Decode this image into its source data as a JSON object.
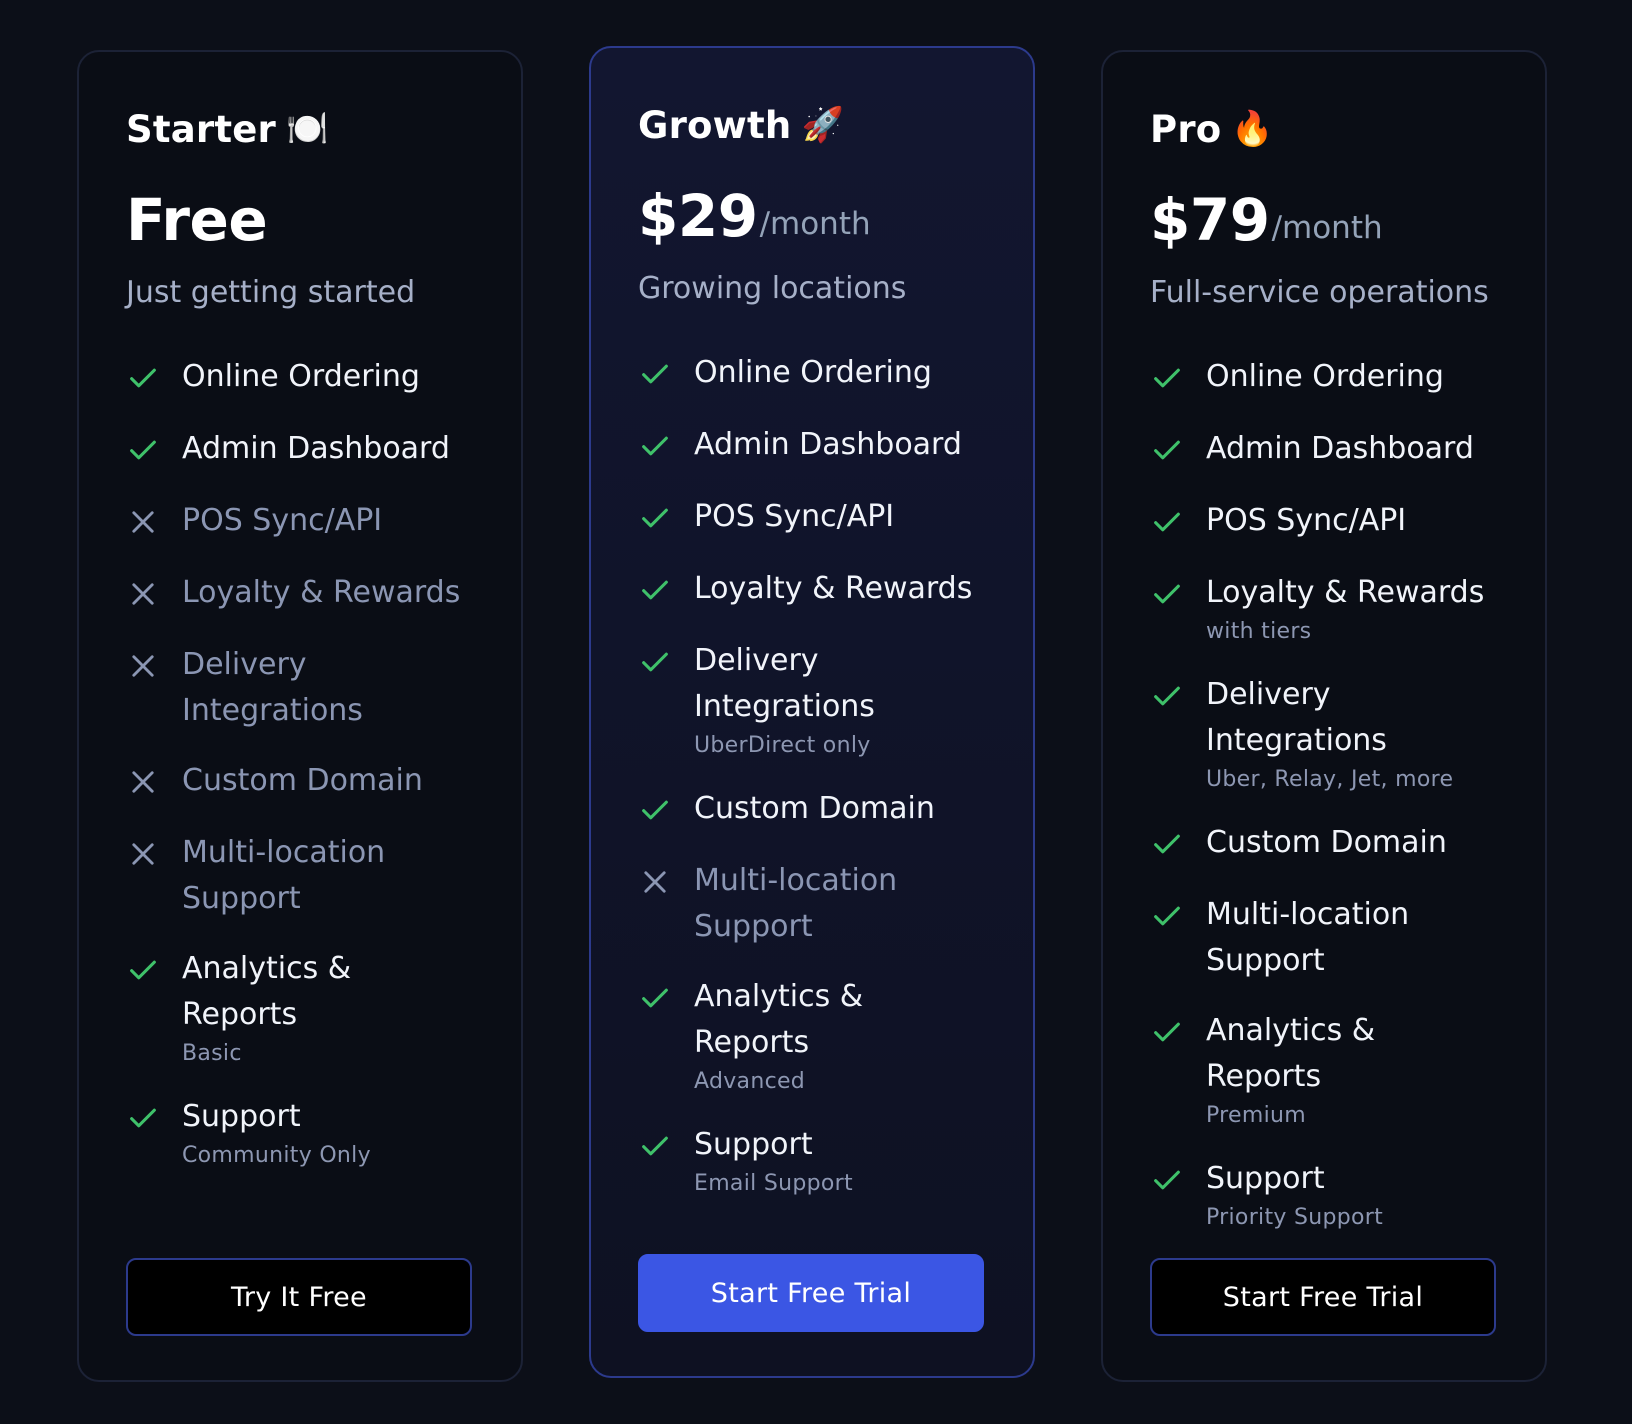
{
  "colors": {
    "background": "#0c0f18",
    "accent": "#3b56e4",
    "check": "#3fc16a",
    "cross": "#8b96b3"
  },
  "plans": [
    {
      "name": "Starter",
      "emoji_icon": "plate-fork-knife-icon",
      "emoji": "🍽️",
      "price": "Free",
      "period": "",
      "tagline": "Just getting started",
      "features": [
        {
          "label": "Online Ordering",
          "note": "",
          "included": true
        },
        {
          "label": "Admin Dashboard",
          "note": "",
          "included": true
        },
        {
          "label": "POS Sync/API",
          "note": "",
          "included": false
        },
        {
          "label": "Loyalty & Rewards",
          "note": "",
          "included": false
        },
        {
          "label": "Delivery Integrations",
          "note": "",
          "included": false
        },
        {
          "label": "Custom Domain",
          "note": "",
          "included": false
        },
        {
          "label": "Multi-location Support",
          "note": "",
          "included": false
        },
        {
          "label": "Analytics & Reports",
          "note": "Basic",
          "included": true
        },
        {
          "label": "Support",
          "note": "Community Only",
          "included": true
        }
      ],
      "cta": "Try It Free"
    },
    {
      "name": "Growth",
      "emoji_icon": "rocket-icon",
      "emoji": "🚀",
      "price": "$29",
      "period": "/month",
      "tagline": "Growing locations",
      "features": [
        {
          "label": "Online Ordering",
          "note": "",
          "included": true
        },
        {
          "label": "Admin Dashboard",
          "note": "",
          "included": true
        },
        {
          "label": "POS Sync/API",
          "note": "",
          "included": true
        },
        {
          "label": "Loyalty & Rewards",
          "note": "",
          "included": true
        },
        {
          "label": "Delivery Integrations",
          "note": "UberDirect only",
          "included": true
        },
        {
          "label": "Custom Domain",
          "note": "",
          "included": true
        },
        {
          "label": "Multi-location Support",
          "note": "",
          "included": false
        },
        {
          "label": "Analytics & Reports",
          "note": "Advanced",
          "included": true
        },
        {
          "label": "Support",
          "note": "Email Support",
          "included": true
        }
      ],
      "cta": "Start Free Trial"
    },
    {
      "name": "Pro",
      "emoji_icon": "fire-icon",
      "emoji": "🔥",
      "price": "$79",
      "period": "/month",
      "tagline": "Full-service operations",
      "features": [
        {
          "label": "Online Ordering",
          "note": "",
          "included": true
        },
        {
          "label": "Admin Dashboard",
          "note": "",
          "included": true
        },
        {
          "label": "POS Sync/API",
          "note": "",
          "included": true
        },
        {
          "label": "Loyalty & Rewards",
          "note": "with tiers",
          "included": true
        },
        {
          "label": "Delivery Integrations",
          "note": "Uber, Relay, Jet, more",
          "included": true
        },
        {
          "label": "Custom Domain",
          "note": "",
          "included": true
        },
        {
          "label": "Multi-location Support",
          "note": "",
          "included": true
        },
        {
          "label": "Analytics & Reports",
          "note": "Premium",
          "included": true
        },
        {
          "label": "Support",
          "note": "Priority Support",
          "included": true
        }
      ],
      "cta": "Start Free Trial"
    }
  ]
}
